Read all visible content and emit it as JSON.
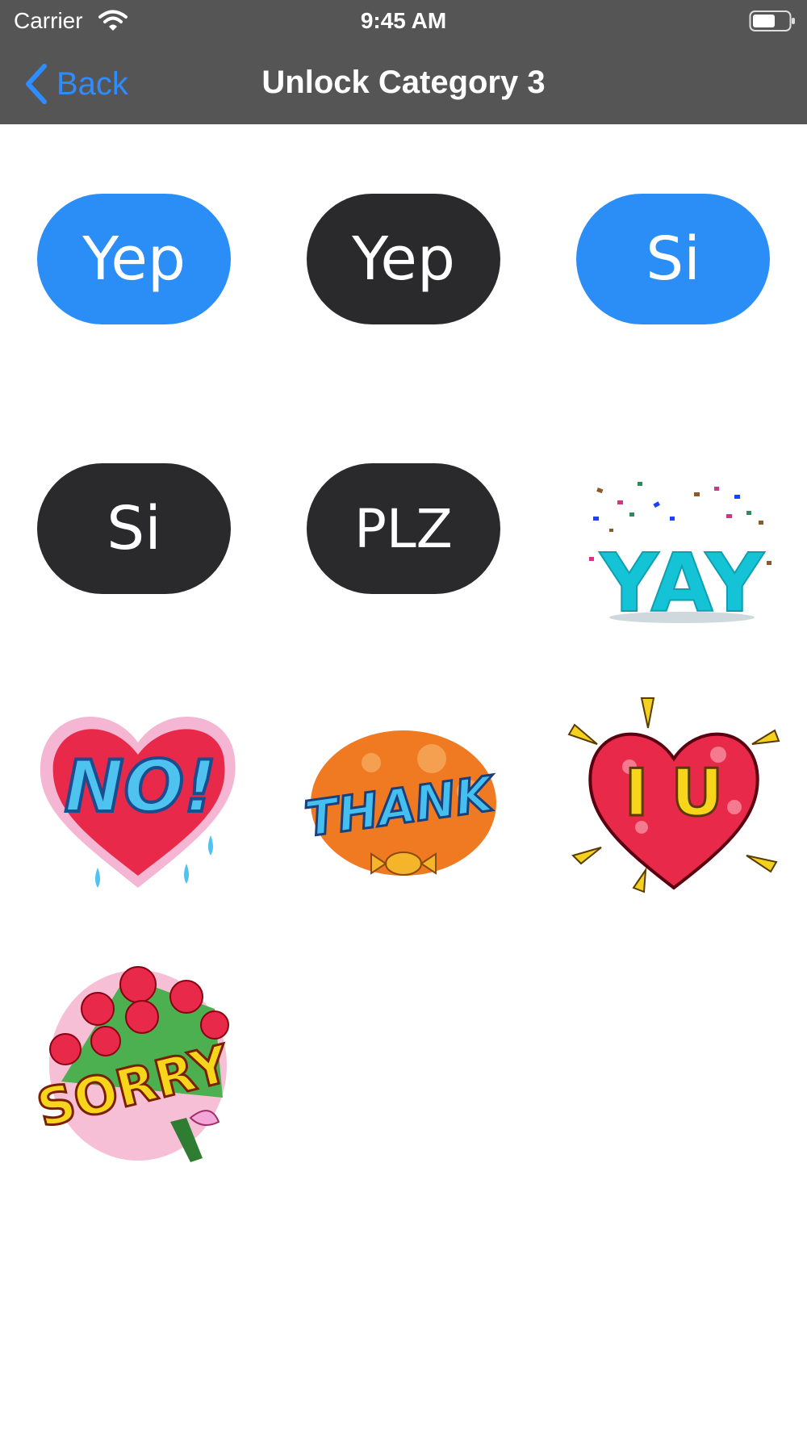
{
  "status_bar": {
    "carrier": "Carrier",
    "time": "9:45 AM",
    "icons": [
      "wifi-icon",
      "battery-icon"
    ]
  },
  "nav": {
    "back_label": "Back",
    "title": "Unlock Category 3"
  },
  "stickers": [
    {
      "text": "Yep",
      "style": "blue"
    },
    {
      "text": "Yep",
      "style": "dark"
    },
    {
      "text": "Si",
      "style": "blue"
    },
    {
      "text": "Si",
      "style": "dark"
    },
    {
      "text": "PLZ",
      "style": "dark"
    },
    {
      "text": "YAY",
      "style": "illustration"
    },
    {
      "text": "NO!",
      "style": "illustration"
    },
    {
      "text": "THANK",
      "style": "illustration"
    },
    {
      "text": "I U",
      "style": "illustration"
    },
    {
      "text": "SORRY",
      "style": "illustration"
    }
  ],
  "colors": {
    "nav_background": "#555555",
    "accent": "#2f8cff",
    "bubble_blue": "#2b8ef7",
    "bubble_dark": "#2a2a2c"
  }
}
